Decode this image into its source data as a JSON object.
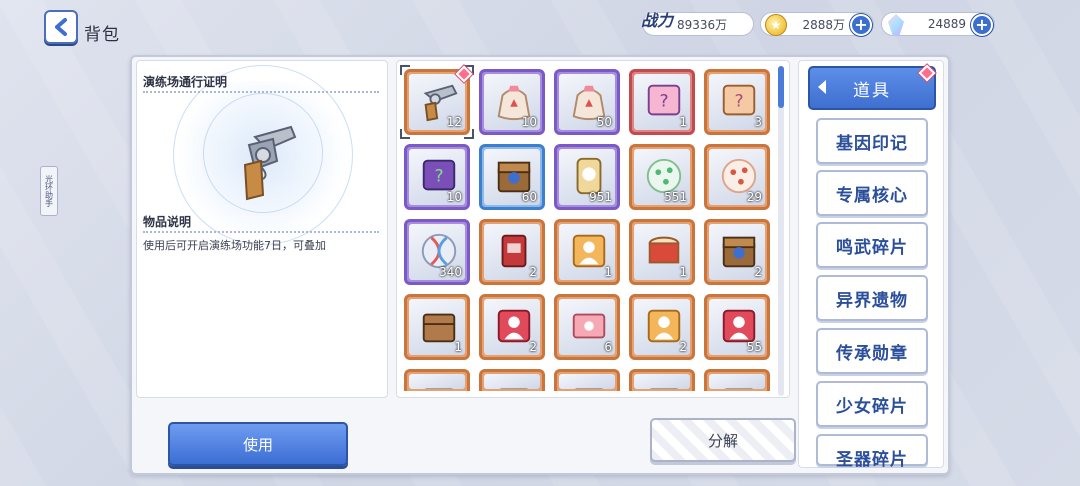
{
  "header": {
    "title": "背包",
    "power_label": "战力",
    "power_value": "89336万",
    "gold_value": "2888万",
    "gem_value": "24889"
  },
  "side_helper": {
    "label": "光环助手"
  },
  "detail": {
    "item_name": "演练场通行证明",
    "desc_title": "物品说明",
    "desc_text": "使用后可开启演练场功能7日，可叠加"
  },
  "buttons": {
    "use_label": "使用",
    "decompose_label": "分解"
  },
  "tabs": {
    "active": "道具",
    "items": [
      "基因印记",
      "专属核心",
      "鸣武碎片",
      "异界遗物",
      "传承勋章",
      "少女碎片",
      "圣器碎片"
    ]
  },
  "items": [
    {
      "name": "revolver-item",
      "qty": "12",
      "rarity": "orange",
      "art": "revolver"
    },
    {
      "name": "gift-bag-item",
      "qty": "10",
      "rarity": "purple",
      "art": "bag"
    },
    {
      "name": "gift-bag-item",
      "qty": "50",
      "rarity": "purple",
      "art": "bag"
    },
    {
      "name": "mystery-box-item",
      "qty": "1",
      "rarity": "red",
      "art": "mystery-pink"
    },
    {
      "name": "mystery-box-item",
      "qty": "3",
      "rarity": "orange",
      "art": "mystery-orange"
    },
    {
      "name": "mystery-box-item",
      "qty": "10",
      "rarity": "purple",
      "art": "mystery-green"
    },
    {
      "name": "chest-item",
      "qty": "60",
      "rarity": "blue",
      "art": "chest"
    },
    {
      "name": "can-item",
      "qty": "951",
      "rarity": "purple",
      "art": "can"
    },
    {
      "name": "orb-item",
      "qty": "551",
      "rarity": "orange",
      "art": "orb-green"
    },
    {
      "name": "orb-item",
      "qty": "29",
      "rarity": "orange",
      "art": "orb-red"
    },
    {
      "name": "dna-item",
      "qty": "340",
      "rarity": "purple",
      "art": "dna"
    },
    {
      "name": "card-item",
      "qty": "2",
      "rarity": "orange",
      "art": "card"
    },
    {
      "name": "silhouette-item",
      "qty": "1",
      "rarity": "orange",
      "art": "silhouette-gold"
    },
    {
      "name": "drum-item",
      "qty": "1",
      "rarity": "orange",
      "art": "drum"
    },
    {
      "name": "chest-item",
      "qty": "2",
      "rarity": "orange",
      "art": "chest"
    },
    {
      "name": "crate-item",
      "qty": "1",
      "rarity": "orange",
      "art": "crate"
    },
    {
      "name": "silhouette-item",
      "qty": "2",
      "rarity": "orange",
      "art": "silhouette-red"
    },
    {
      "name": "ticket-item",
      "qty": "6",
      "rarity": "orange",
      "art": "ticket"
    },
    {
      "name": "silhouette-item",
      "qty": "2",
      "rarity": "orange",
      "art": "silhouette-gold"
    },
    {
      "name": "silhouette-item",
      "qty": "55",
      "rarity": "orange",
      "art": "silhouette-red"
    },
    {
      "name": "crate-item",
      "qty": "",
      "rarity": "orange",
      "art": "crate"
    },
    {
      "name": "crate-item",
      "qty": "",
      "rarity": "orange",
      "art": "crate"
    },
    {
      "name": "crate-item",
      "qty": "",
      "rarity": "orange",
      "art": "crate"
    },
    {
      "name": "crate-item",
      "qty": "",
      "rarity": "orange",
      "art": "crate"
    },
    {
      "name": "crate-item",
      "qty": "",
      "rarity": "orange",
      "art": "crate"
    }
  ],
  "colors": {
    "accent": "#3f6fd0",
    "rarity_orange": "#c9753c",
    "rarity_purple": "#7a5bc5",
    "rarity_red": "#c24b4b",
    "rarity_blue": "#3d7fcf"
  }
}
